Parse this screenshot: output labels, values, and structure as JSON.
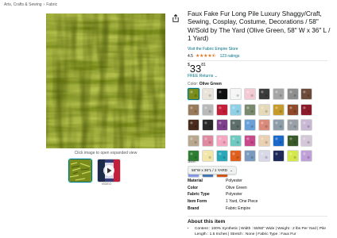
{
  "breadcrumb": [
    "Arts, Crafts & Sewing",
    "Fabric"
  ],
  "breadcrumb_sep": "›",
  "gallery": {
    "expand_caption": "Click image to open expanded view",
    "video_label": "VIDEO",
    "main_color": "#7a8c1c"
  },
  "product": {
    "title": "Faux Fake Fur Long Pile Luxury Shaggy/Craft, Sewing, Cosplay, Costume, Decorations / 58\" W/Sold by The Yard (Olive Green, 58\" W x 36\" L / 1 Yard)",
    "store_link": "Visit the Fabric Empire Store",
    "rating_value": "4.5",
    "stars": "★★★★⯪",
    "rating_stars": 4.5,
    "ratings_count": "123 ratings",
    "price_currency": "$",
    "price_whole": "33",
    "price_fraction": "81",
    "returns": "FREE Returns",
    "returns_chevron": "⌄"
  },
  "color": {
    "label": "Color:",
    "selected": "Olive Green",
    "swatches": [
      "#7a8c1c",
      "#e9e4da",
      "#111111",
      "#f5f5f5",
      "#f3c9d3",
      "#3b3b3b",
      "#a6a6a6",
      "#8e8e8e",
      "#6d4a3a",
      "#9a7a5c",
      "#b9b9b9",
      "#c41e3a",
      "#8fd0e6",
      "#7a8a6e",
      "#e6d9b8",
      "#c79a2c",
      "#8e4a2a",
      "#8d1a2a",
      "#4a2a1a",
      "#2a2a2a",
      "#7e3f8c",
      "#5e6e6a",
      "#6aa0d8",
      "#d98a7a",
      "#8e9ea8",
      "#9aa0a6",
      "#c9b8d4",
      "#b9a88e",
      "#e08aa0",
      "#f5a6c0",
      "#6fc9c0",
      "#c94a8a",
      "#e8d0b0",
      "#1b6ac9",
      "#3a5a2a",
      "#d4c8d8",
      "#2e7d32",
      "#f2e6a8",
      "#2aa8b8",
      "#e06020",
      "#7a9bbf",
      "#d8d8e8",
      "#1e2a5a",
      "#d4e84a",
      "#c0a0d8",
      "#8aa0f0",
      "#4a7ab8",
      "#d85a1a"
    ],
    "selected_index": 0
  },
  "size": {
    "label": "Size:",
    "selected": "58\"W x 36\"L / 1 YARD",
    "chevron": "⌄"
  },
  "specs": [
    {
      "key": "Material",
      "value": "Polyester"
    },
    {
      "key": "Color",
      "value": "Olive Green"
    },
    {
      "key": "Fabric Type",
      "value": "Polyester"
    },
    {
      "key": "Item Form",
      "value": "1 Yard, One Piece"
    },
    {
      "key": "Brand",
      "value": "Fabric Empire"
    }
  ],
  "about": {
    "title": "About this item",
    "bullets": [
      "Content : 100% Synthetic | Width : 58/60\" Wide | Weight : 2 lbs Per Yard | Pile Length : 1.5 Inches | Stretch : None | Fabric Type : Faux Fur"
    ]
  }
}
